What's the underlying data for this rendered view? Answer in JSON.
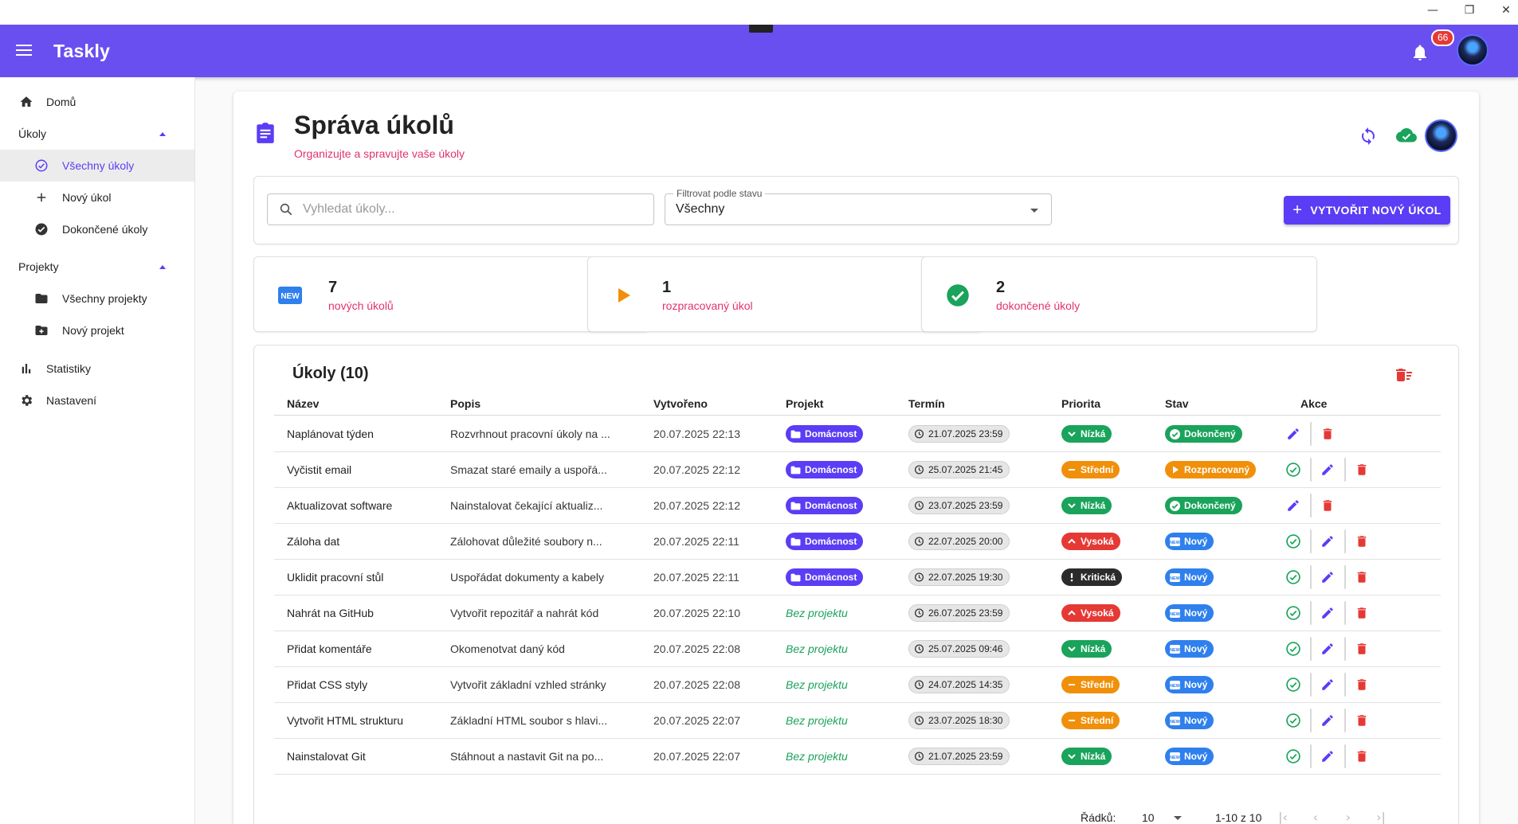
{
  "window": {
    "minimize": "—",
    "restore": "❐",
    "close": "✕"
  },
  "appbar": {
    "title": "Taskly",
    "notifications": "66"
  },
  "sidebar": {
    "home": "Domů",
    "tasks_header": "Úkoly",
    "tasks_items": [
      {
        "label": "Všechny úkoly",
        "icon": "check-circle-outline-icon",
        "active": true
      },
      {
        "label": "Nový úkol",
        "icon": "plus-icon"
      },
      {
        "label": "Dokončené úkoly",
        "icon": "check-circle-icon"
      }
    ],
    "projects_header": "Projekty",
    "projects_items": [
      {
        "label": "Všechny projekty",
        "icon": "folder-icon"
      },
      {
        "label": "Nový projekt",
        "icon": "folder-plus-icon"
      }
    ],
    "stats": "Statistiky",
    "settings": "Nastavení"
  },
  "page": {
    "title": "Správa úkolů",
    "subtitle": "Organizujte a spravujte vaše úkoly"
  },
  "filter": {
    "search_placeholder": "Vyhledat úkoly...",
    "status_label": "Filtrovat podle stavu",
    "status_value": "Všechny",
    "create_label": "VYTVOŘIT NOVÝ ÚKOL"
  },
  "stats": [
    {
      "count": "7",
      "label": "nových úkolů",
      "icon": "new-icon"
    },
    {
      "count": "1",
      "label": "rozpracovaný úkol",
      "icon": "play-icon"
    },
    {
      "count": "2",
      "label": "dokončené úkoly",
      "icon": "check-circle-icon"
    }
  ],
  "table": {
    "title": "Úkoly (10)",
    "columns": [
      "Název",
      "Popis",
      "Vytvořeno",
      "Projekt",
      "Termín",
      "Priorita",
      "Stav",
      "Akce"
    ],
    "rows": [
      {
        "name": "Naplánovat týden",
        "desc": "Rozvrhnout pracovní úkoly na ...",
        "created": "20.07.2025 22:13",
        "project": "Domácnost",
        "due": "21.07.2025 23:59",
        "priority": "Nízká",
        "status": "Dokončený",
        "completable": false
      },
      {
        "name": "Vyčistit email",
        "desc": "Smazat staré emaily a uspořá...",
        "created": "20.07.2025 22:12",
        "project": "Domácnost",
        "due": "25.07.2025 21:45",
        "priority": "Střední",
        "status": "Rozpracovaný",
        "completable": true
      },
      {
        "name": "Aktualizovat software",
        "desc": "Nainstalovat čekající aktualiz...",
        "created": "20.07.2025 22:12",
        "project": "Domácnost",
        "due": "23.07.2025 23:59",
        "priority": "Nízká",
        "status": "Dokončený",
        "completable": false
      },
      {
        "name": "Záloha dat",
        "desc": "Zálohovat důležité soubory n...",
        "created": "20.07.2025 22:11",
        "project": "Domácnost",
        "due": "22.07.2025 20:00",
        "priority": "Vysoká",
        "status": "Nový",
        "completable": true
      },
      {
        "name": "Uklidit pracovní stůl",
        "desc": "Uspořádat dokumenty a kabely",
        "created": "20.07.2025 22:11",
        "project": "Domácnost",
        "due": "22.07.2025 19:30",
        "priority": "Kritická",
        "status": "Nový",
        "completable": true
      },
      {
        "name": "Nahrát na GitHub",
        "desc": "Vytvořit repozitář a nahrát kód",
        "created": "20.07.2025 22:10",
        "project": "Bez projektu",
        "due": "26.07.2025 23:59",
        "priority": "Vysoká",
        "status": "Nový",
        "completable": true
      },
      {
        "name": "Přidat komentáře",
        "desc": "Okomenotvat daný kód",
        "created": "20.07.2025 22:08",
        "project": "Bez projektu",
        "due": "25.07.2025 09:46",
        "priority": "Nízká",
        "status": "Nový",
        "completable": true
      },
      {
        "name": "Přidat CSS styly",
        "desc": "Vytvořit základní vzhled stránky",
        "created": "20.07.2025 22:08",
        "project": "Bez projektu",
        "due": "24.07.2025 14:35",
        "priority": "Střední",
        "status": "Nový",
        "completable": true
      },
      {
        "name": "Vytvořit HTML strukturu",
        "desc": "Základní HTML soubor s hlavi...",
        "created": "20.07.2025 22:07",
        "project": "Bez projektu",
        "due": "23.07.2025 18:30",
        "priority": "Střední",
        "status": "Nový",
        "completable": true
      },
      {
        "name": "Nainstalovat Git",
        "desc": "Stáhnout a nastavit Git na po...",
        "created": "20.07.2025 22:07",
        "project": "Bez projektu",
        "due": "21.07.2025 23:59",
        "priority": "Nízká",
        "status": "Nový",
        "completable": true
      }
    ]
  },
  "pagination": {
    "rows_label": "Řádků:",
    "rows_value": "10",
    "range": "1-10 z 10",
    "first": "|‹",
    "prev": "‹",
    "next": "›",
    "last": "›|"
  },
  "colors": {
    "primary": "#6a4ff0",
    "accent_pink": "#e2336b",
    "low": "#1aa35b",
    "medium": "#f0900a",
    "high": "#e53935",
    "critical": "#2b2b2b",
    "status_new": "#2f80ed",
    "status_done": "#1aa35b",
    "status_progress": "#f0900a"
  }
}
